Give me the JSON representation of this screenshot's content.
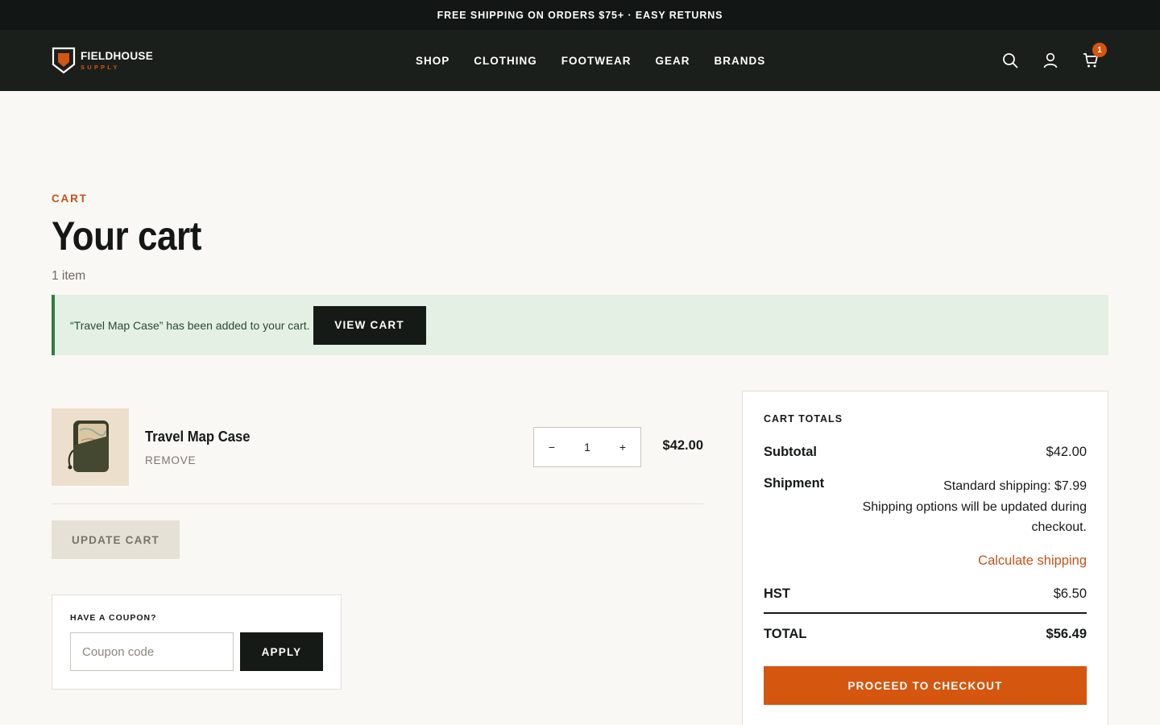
{
  "announcement": "FREE SHIPPING ON ORDERS $75+ · EASY RETURNS",
  "brand": {
    "name": "FIELDHOUSE",
    "tagline": "SUPPLY",
    "accent": "#d4560f"
  },
  "nav": [
    "SHOP",
    "CLOTHING",
    "FOOTWEAR",
    "GEAR",
    "BRANDS"
  ],
  "header_icons": {
    "search": "search-icon",
    "account": "user-icon",
    "cart": "cart-icon",
    "cart_count": "1"
  },
  "page": {
    "eyebrow": "CART",
    "title": "Your cart",
    "item_count": "1 item"
  },
  "notice": {
    "text": "“Travel Map Case” has been added to your cart.",
    "button": "VIEW CART",
    "color": "#2f7d3e"
  },
  "cart": {
    "items": [
      {
        "name": "Travel Map Case",
        "remove_label": "REMOVE",
        "quantity": "1",
        "decrement": "−",
        "increment": "+",
        "price": "$42.00"
      }
    ],
    "update_label": "UPDATE CART"
  },
  "coupon": {
    "label": "HAVE A COUPON?",
    "placeholder": "Coupon code",
    "button": "APPLY"
  },
  "totals": {
    "heading": "CART TOTALS",
    "subtotal_label": "Subtotal",
    "subtotal": "$42.00",
    "shipment_label": "Shipment",
    "shipment_method": "Standard shipping: $7.99",
    "shipment_note_1": "Shipping options will be updated during",
    "shipment_note_2": "checkout.",
    "calculate": "Calculate shipping",
    "tax_label": "HST",
    "tax": "$6.50",
    "total_label": "TOTAL",
    "total": "$56.49",
    "checkout": "PROCEED TO CHECKOUT"
  }
}
